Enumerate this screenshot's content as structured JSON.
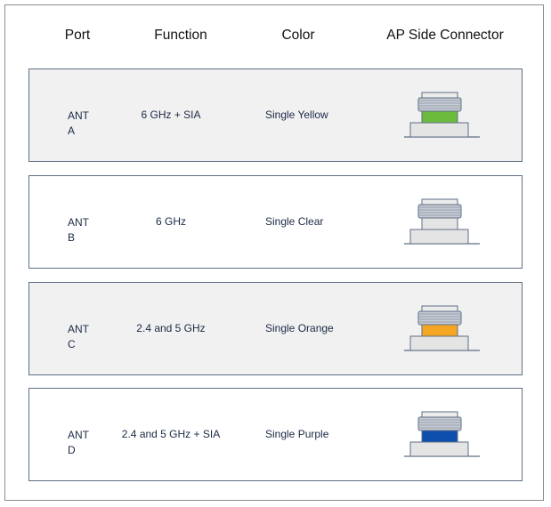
{
  "headers": {
    "port": "Port",
    "function": "Function",
    "color": "Color",
    "connector": "AP Side Connector"
  },
  "rows": [
    {
      "port_line1": "ANT",
      "port_line2": "A",
      "function": "6 GHz + SIA",
      "color": "Single Yellow",
      "band_color": "#6cbb3c",
      "band_icon": "green-band-connector-icon",
      "nut_style": "gray"
    },
    {
      "port_line1": "ANT",
      "port_line2": "B",
      "function": "6 GHz",
      "color": "Single Clear",
      "band_color": "#e4e4e4",
      "band_icon": "clear-band-connector-icon",
      "nut_style": "gray"
    },
    {
      "port_line1": "ANT",
      "port_line2": "C",
      "function": "2.4 and 5 GHz",
      "color": "Single Orange",
      "band_color": "#f5a623",
      "band_icon": "orange-band-connector-icon",
      "nut_style": "gray"
    },
    {
      "port_line1": "ANT",
      "port_line2": "D",
      "function": "2.4 and 5 GHz + SIA",
      "color": "Single Purple",
      "band_color": "#0d4eaa",
      "band_icon": "blue-band-connector-icon",
      "nut_style": "gray"
    }
  ],
  "colors": {
    "row_shade": "#f1f1f1",
    "row_border": "#5e6e85",
    "text": "#1b2a45"
  }
}
